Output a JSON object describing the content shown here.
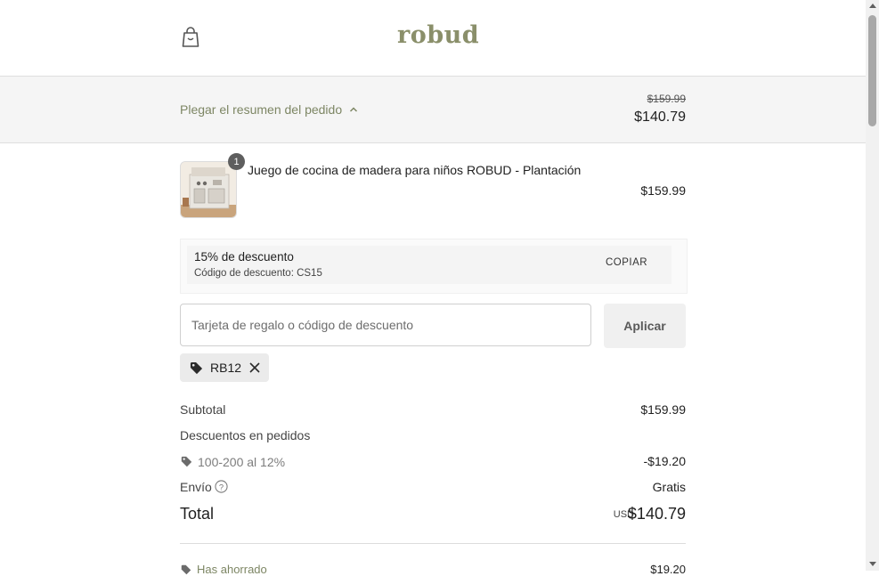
{
  "header": {
    "logo": "robud",
    "bag_icon": "shopping-bag-icon"
  },
  "summary": {
    "toggle_label": "Plegar el resumen del pedido",
    "toggle_icon": "chevron-up-icon",
    "original_price": "$159.99",
    "price": "$140.79"
  },
  "product": {
    "quantity": "1",
    "name": "Juego de cocina de madera para niños ROBUD - Plantación",
    "price": "$159.99"
  },
  "discount_offer": {
    "title": "15% de descuento",
    "code_label": "Código de descuento: CS15",
    "copy_label": "COPIAR"
  },
  "gift": {
    "placeholder": "Tarjeta de regalo o código de descuento",
    "value": "",
    "apply_label": "Aplicar"
  },
  "applied_code": {
    "code": "RB12",
    "tag_icon": "tag-icon",
    "remove_icon": "close-icon"
  },
  "totals": {
    "subtotal_label": "Subtotal",
    "subtotal_value": "$159.99",
    "discounts_label": "Descuentos en pedidos",
    "discount_rule_label": "100-200 al 12%",
    "discount_rule_value": "-$19.20",
    "shipping_label": "Envío",
    "shipping_value": "Gratis",
    "total_label": "Total",
    "currency": "USD",
    "total_value": "$140.79",
    "saved_label": "Has ahorrado",
    "saved_value": "$19.20"
  },
  "colors": {
    "brand": "#8a8f6a",
    "accent_text": "#7d8664",
    "summary_bg": "#f5f5f5"
  }
}
